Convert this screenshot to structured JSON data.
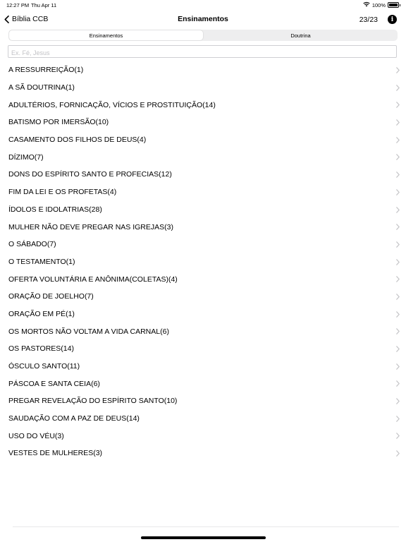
{
  "status_bar": {
    "time": "12:27 PM",
    "date": "Thu Apr 11",
    "battery": "100%",
    "icons": [
      "wifi-icon",
      "battery-icon"
    ]
  },
  "nav": {
    "back_label": "Bíblia CCB",
    "title": "Ensinamentos",
    "count": "23/23",
    "info_icon": "i"
  },
  "segments": {
    "first": "Ensinamentos",
    "second": "Doutrina",
    "selected": "Ensinamentos"
  },
  "search": {
    "placeholder": "Ex. Fé, Jesus",
    "value": ""
  },
  "list": {
    "items": [
      {
        "label": "A RESSURREIÇÃO(1)"
      },
      {
        "label": "A SÃ DOUTRINA(1)"
      },
      {
        "label": "ADULTÉRIOS, FORNICAÇÃO, VÍCIOS E PROSTITUIÇÃO(14)"
      },
      {
        "label": "BATISMO POR IMERSÃO(10)"
      },
      {
        "label": "CASAMENTO DOS FILHOS DE DEUS(4)"
      },
      {
        "label": "DÍZIMO(7)"
      },
      {
        "label": "DONS DO ESPÍRITO SANTO E PROFECIAS(12)"
      },
      {
        "label": "FIM DA LEI E OS PROFETAS(4)"
      },
      {
        "label": "ÍDOLOS E IDOLATRIAS(28)"
      },
      {
        "label": "MULHER NÃO DEVE PREGAR NAS IGREJAS(3)"
      },
      {
        "label": "O SÁBADO(7)"
      },
      {
        "label": "O TESTAMENTO(1)"
      },
      {
        "label": "OFERTA VOLUNTÁRIA E ANÔNIMA(COLETAS)(4)"
      },
      {
        "label": "ORAÇÃO DE JOELHO(7)"
      },
      {
        "label": "ORAÇÃO EM PÉ(1)"
      },
      {
        "label": "OS MORTOS NÃO VOLTAM A VIDA CARNAL(6)"
      },
      {
        "label": "OS PASTORES(14)"
      },
      {
        "label": "ÓSCULO SANTO(11)"
      },
      {
        "label": "PÁSCOA E SANTA CEIA(6)"
      },
      {
        "label": "PREGAR REVELAÇÃO DO ESPÍRITO SANTO(10)"
      },
      {
        "label": "SAUDAÇÃO COM A PAZ DE DEUS(14)"
      },
      {
        "label": "USO DO VÉU(3)"
      },
      {
        "label": "VESTES DE MULHERES(3)"
      }
    ]
  },
  "colors": {
    "chevron": "#c4c4c7",
    "segment_bg": "#eeeeef",
    "search_border": "#cfcfd3",
    "placeholder": "#c2c2c6"
  }
}
